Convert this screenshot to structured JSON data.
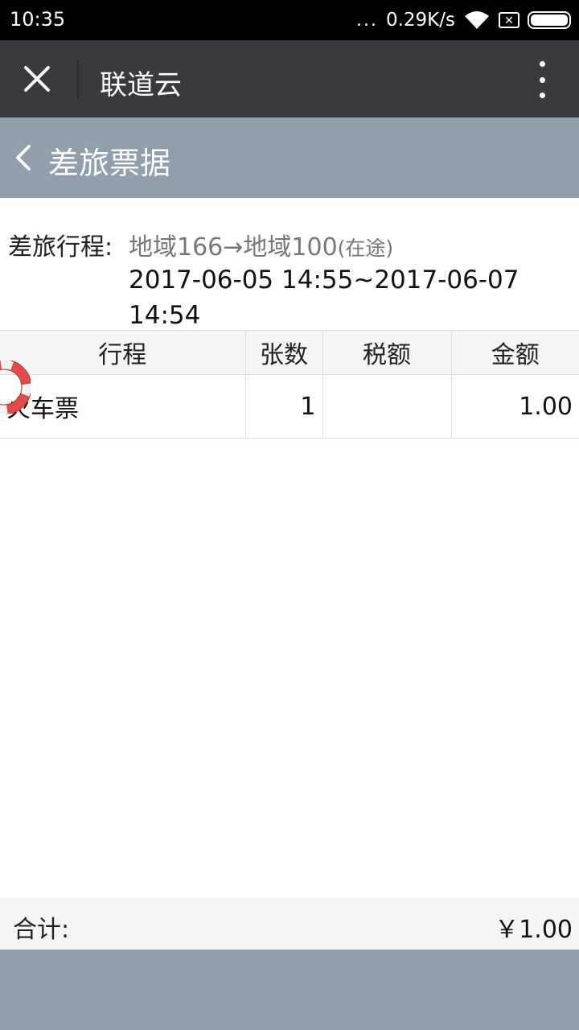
{
  "status_bar": {
    "time": "10:35",
    "dots": "...",
    "net_speed": "0.29K/s",
    "sim_symbol": "✕"
  },
  "wechat_header": {
    "title": "联道云",
    "close_icon": "close-icon",
    "more_icon": "more-vertical-icon"
  },
  "page_header": {
    "title": "差旅票据",
    "back_icon": "chevron-left-icon"
  },
  "trip": {
    "label": "差旅行程:",
    "route": "地域166→地域100",
    "status": "(在途)",
    "dates": "2017-06-05 14:55~2017-06-07 14:54"
  },
  "table": {
    "headers": [
      "行程",
      "张数",
      "税额",
      "金额"
    ],
    "rows": [
      {
        "trip": "火车票",
        "count": "1",
        "tax": "",
        "amount": "1.00"
      }
    ]
  },
  "footer": {
    "total_label": "合计:",
    "total_amount": "￥1.00"
  },
  "colors": {
    "wechat_header_bg": "#393a3f",
    "page_header_bg": "#919fac",
    "table_header_bg": "#f5f5f5"
  }
}
